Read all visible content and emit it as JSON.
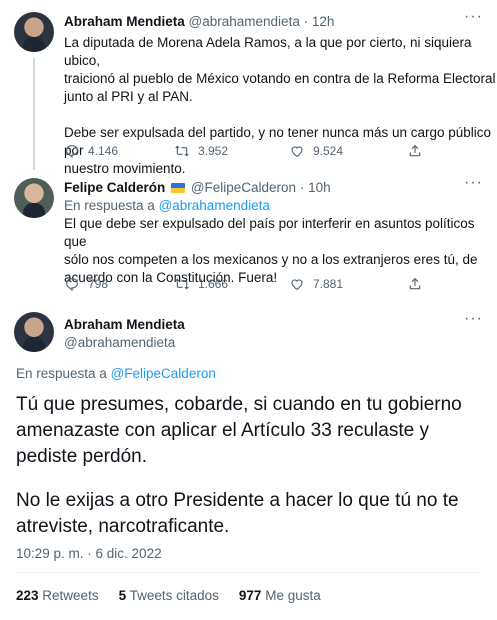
{
  "tweet1": {
    "name": "Abraham Mendieta",
    "handle": "@abrahamendieta",
    "time": "· 12h",
    "more": "···",
    "text_lines": [
      "La diputada de Morena Adela Ramos, a la que por cierto, ni siquiera ubico,",
      "traicionó al pueblo de México votando en contra de la Reforma Electoral",
      "junto al PRI y al PAN."
    ],
    "text_lines2": [
      "Debe ser expulsada del partido, y no tener nunca más un cargo público por",
      "nuestro movimiento."
    ],
    "replies": "4.146",
    "retweets": "3.952",
    "likes": "9.524"
  },
  "tweet2": {
    "name": "Felipe Calderón",
    "handle": "@FelipeCalderon",
    "time": "· 10h",
    "more": "···",
    "reply_prefix": "En respuesta a",
    "reply_handle": "@abrahamendieta",
    "text_lines": [
      "El que debe ser expulsado del país por interferir en asuntos políticos que",
      "sólo nos competen a los mexicanos y no a los extranjeros eres tú, de",
      "acuerdo con la Constitución. Fuera!"
    ],
    "replies": "798",
    "retweets": "1.666",
    "likes": "7.881"
  },
  "tweet3": {
    "name": "Abraham Mendieta",
    "handle": "@abrahamendieta",
    "more": "···",
    "reply_prefix": "En respuesta a",
    "reply_handle": "@FelipeCalderon",
    "text_lines": [
      "Tú que presumes, cobarde, si cuando en tu gobierno",
      "amenazaste con aplicar el Artículo 33 reculaste y",
      "pediste perdón."
    ],
    "text_lines2": [
      "No le exijas a otro Presidente a hacer lo que tú no te",
      "atreviste, narcotraficante."
    ],
    "timestamp": "10:29 p. m. · 6 dic. 2022",
    "stats": {
      "retweets_count": "223",
      "retweets_label": "Retweets",
      "quotes_count": "5",
      "quotes_label": "Tweets citados",
      "likes_count": "977",
      "likes_label": "Me gusta"
    }
  },
  "colors": {
    "accent": "#1d9bf0",
    "secondary": "#536471",
    "text": "#0f1419"
  }
}
